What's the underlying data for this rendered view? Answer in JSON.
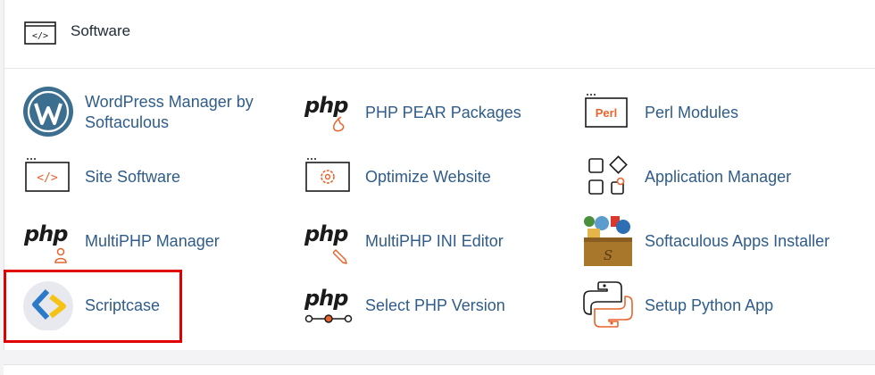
{
  "section": {
    "title": "Software",
    "icon": "code-window-icon"
  },
  "items": [
    {
      "label": "WordPress Manager by Softaculous",
      "label_line1": "WordPress Manager by",
      "label_line2": "Softaculous",
      "icon": "wordpress-icon"
    },
    {
      "label": "PHP PEAR Packages",
      "icon": "php-pear-icon",
      "php_text": "php"
    },
    {
      "label": "Perl Modules",
      "icon": "perl-icon",
      "icon_text": "Perl"
    },
    {
      "label": "Site Software",
      "icon": "code-window-icon"
    },
    {
      "label": "Optimize Website",
      "icon": "optimize-gear-icon"
    },
    {
      "label": "Application Manager",
      "icon": "app-grid-icon"
    },
    {
      "label": "MultiPHP Manager",
      "icon": "php-user-icon",
      "php_text": "php"
    },
    {
      "label": "MultiPHP INI Editor",
      "icon": "php-edit-icon",
      "php_text": "php"
    },
    {
      "label": "Softaculous Apps Installer",
      "icon": "softaculous-box-icon"
    },
    {
      "label": "Scriptcase",
      "icon": "scriptcase-icon"
    },
    {
      "label": "Select PHP Version",
      "icon": "php-version-slider-icon",
      "php_text": "php"
    },
    {
      "label": "Setup Python App",
      "icon": "python-icon"
    }
  ],
  "colors": {
    "label": "#2f5c8a",
    "accent": "#e8642c",
    "highlight": "#e00000"
  }
}
